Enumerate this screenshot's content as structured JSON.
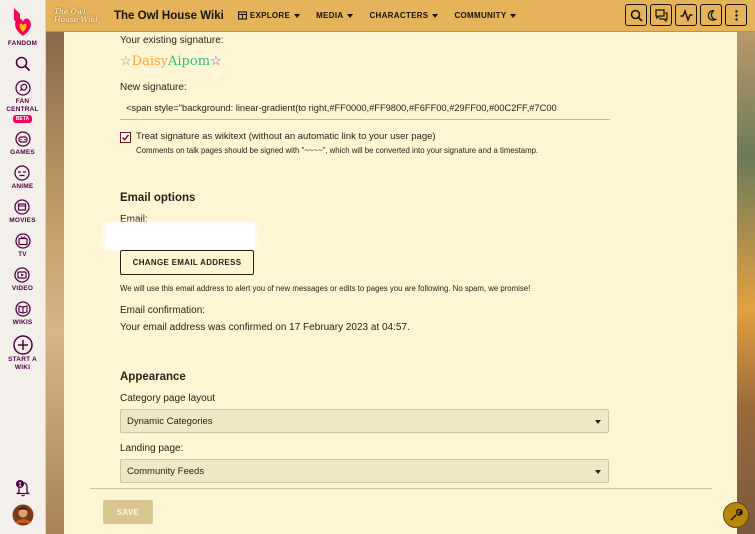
{
  "rail": {
    "fandom_label": "FANDOM",
    "fan_central_label": "FAN CENTRAL",
    "beta_badge": "BETA",
    "games_label": "GAMES",
    "anime_label": "ANIME",
    "movies_label": "MOVIES",
    "tv_label": "TV",
    "video_label": "VIDEO",
    "wikis_label": "WIKIS",
    "start_wiki_label": "START A WIKI",
    "notification_count": "1"
  },
  "header": {
    "logo_line1": "The Owl",
    "logo_line2": "House Wiki",
    "wiki_title": "The Owl House Wiki",
    "nav": {
      "explore": "EXPLORE",
      "media": "MEDIA",
      "characters": "CHARACTERS",
      "community": "COMMUNITY"
    }
  },
  "signature": {
    "existing_label": "Your existing signature:",
    "existing_parts": [
      "☆",
      "Daisy",
      " ",
      "Aipom",
      "☆"
    ],
    "new_label": "New signature:",
    "new_value": "<span style=\"background: linear-gradient(to right,#FF0000,#FF9800,#F6FF00,#29FF00,#00C2FF,#7C00",
    "wikitext_label": "Treat signature as wikitext (without an automatic link to your user page)",
    "help_text": "Comments on talk pages should be signed with \"~~~~\", which will be converted into your signature and a timestamp."
  },
  "email": {
    "heading": "Email options",
    "email_label": "Email:",
    "change_button": "CHANGE EMAIL ADDRESS",
    "note": "We will use this email address to alert you of new messages or edits to pages you are following. No spam, we promise!",
    "confirmation_label": "Email confirmation:",
    "confirmation_text": "Your email address was confirmed on 17 February 2023 at 04:57."
  },
  "appearance": {
    "heading": "Appearance",
    "category_label": "Category page layout",
    "category_value": "Dynamic Categories",
    "landing_label": "Landing page:",
    "landing_value": "Community Feeds"
  },
  "save_button": "SAVE",
  "colors": {
    "header_bg": "#e5b35a",
    "panel_bg": "#fdf5d4",
    "fandom_pink": "#fa005a",
    "rail_text": "#520044"
  }
}
